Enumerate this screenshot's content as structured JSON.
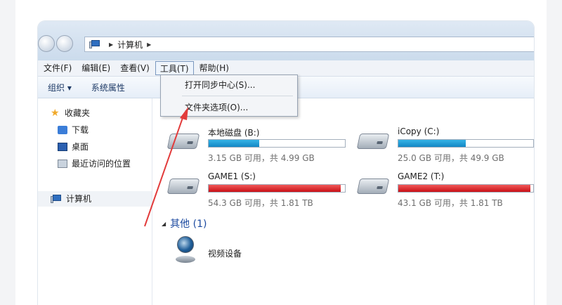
{
  "address": {
    "path": "计算机"
  },
  "menubar": {
    "items": [
      {
        "label": "文件(F)"
      },
      {
        "label": "编辑(E)"
      },
      {
        "label": "查看(V)"
      },
      {
        "label": "工具(T)"
      },
      {
        "label": "帮助(H)"
      }
    ]
  },
  "toolbar": {
    "organize": "组织 ▾",
    "system_properties": "系统属性"
  },
  "tools_menu": {
    "items": [
      {
        "label": "打开同步中心(S)..."
      },
      {
        "label": "文件夹选项(O)..."
      }
    ]
  },
  "sidebar": {
    "favorites": "收藏夹",
    "downloads": "下载",
    "desktop": "桌面",
    "recent": "最近访问的位置",
    "computer": "计算机"
  },
  "drives": [
    {
      "name": "本地磁盘 (B:)",
      "free_text": "3.15 GB 可用，共 4.99 GB",
      "used_fraction": 0.37,
      "color": "blue"
    },
    {
      "name": "iCopy (C:)",
      "free_text": "25.0 GB 可用，共 49.9 GB",
      "used_fraction": 0.5,
      "color": "blue"
    },
    {
      "name": "GAME1 (S:)",
      "free_text": "54.3 GB 可用，共 1.81 TB",
      "used_fraction": 0.97,
      "color": "red"
    },
    {
      "name": "GAME2 (T:)",
      "free_text": "43.1 GB 可用，共 1.81 TB",
      "used_fraction": 0.98,
      "color": "red"
    }
  ],
  "other_group": {
    "label": "其他 (1)",
    "device": "视频设备"
  },
  "colors": {
    "annotation_arrow": "#e23b3b"
  }
}
